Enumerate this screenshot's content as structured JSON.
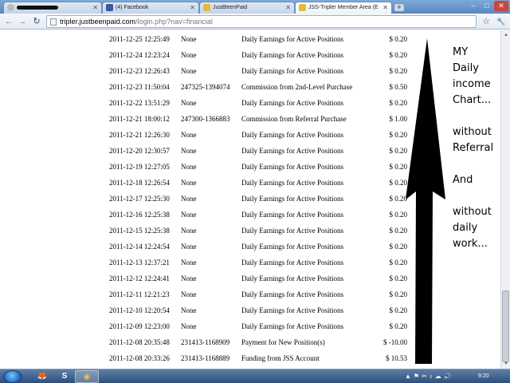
{
  "browser": {
    "tabs": [
      {
        "label": "",
        "redacted": true
      },
      {
        "label": "(4) Facebook"
      },
      {
        "label": "JustBeenPaid"
      },
      {
        "label": "JSS-Tripler Member Area (E",
        "active": true
      }
    ],
    "new_tab_label": "+",
    "window_controls": {
      "minimize": "–",
      "maximize": "□",
      "close": "✕"
    },
    "address": {
      "host": "tripler.justbeenpaid.com",
      "path": "/login.php?nav=financial"
    },
    "buttons": {
      "back": "←",
      "forward": "→",
      "reload": "↻",
      "star": "☆",
      "wrench": "🔧"
    }
  },
  "transactions": [
    {
      "date": "2011-12-25 12:25:49",
      "ref": "None",
      "description": "Daily Earnings for Active Positions",
      "amount": "$ 0.20"
    },
    {
      "date": "2011-12-24 12:23:24",
      "ref": "None",
      "description": "Daily Earnings for Active Positions",
      "amount": "$ 0.20"
    },
    {
      "date": "2011-12-23 12:26:43",
      "ref": "None",
      "description": "Daily Earnings for Active Positions",
      "amount": "$ 0.20"
    },
    {
      "date": "2011-12-23 11:50:04",
      "ref": "247325-1394074",
      "description": "Commission from 2nd-Level Purchase",
      "amount": "$ 0.50"
    },
    {
      "date": "2011-12-22 13:51:29",
      "ref": "None",
      "description": "Daily Earnings for Active Positions",
      "amount": "$ 0.20"
    },
    {
      "date": "2011-12-21 18:00:12",
      "ref": "247300-1366883",
      "description": "Commission from Referral Purchase",
      "amount": "$ 1.00"
    },
    {
      "date": "2011-12-21 12:26:30",
      "ref": "None",
      "description": "Daily Earnings for Active Positions",
      "amount": "$ 0.20"
    },
    {
      "date": "2011-12-20 12:30:57",
      "ref": "None",
      "description": "Daily Earnings for Active Positions",
      "amount": "$ 0.20"
    },
    {
      "date": "2011-12-19 12:27:05",
      "ref": "None",
      "description": "Daily Earnings for Active Positions",
      "amount": "$ 0.20"
    },
    {
      "date": "2011-12-18 12:26:54",
      "ref": "None",
      "description": "Daily Earnings for Active Positions",
      "amount": "$ 0.20"
    },
    {
      "date": "2011-12-17 12:25:30",
      "ref": "None",
      "description": "Daily Earnings for Active Positions",
      "amount": "$ 0.20"
    },
    {
      "date": "2011-12-16 12:25:38",
      "ref": "None",
      "description": "Daily Earnings for Active Positions",
      "amount": "$ 0.20"
    },
    {
      "date": "2011-12-15 12:25:38",
      "ref": "None",
      "description": "Daily Earnings for Active Positions",
      "amount": "$ 0.20"
    },
    {
      "date": "2011-12-14 12:24:54",
      "ref": "None",
      "description": "Daily Earnings for Active Positions",
      "amount": "$ 0.20"
    },
    {
      "date": "2011-12-13 12:37:21",
      "ref": "None",
      "description": "Daily Earnings for Active Positions",
      "amount": "$ 0.20"
    },
    {
      "date": "2011-12-12 12:24:41",
      "ref": "None",
      "description": "Daily Earnings for Active Positions",
      "amount": "$ 0.20"
    },
    {
      "date": "2011-12-11 12:21:23",
      "ref": "None",
      "description": "Daily Earnings for Active Positions",
      "amount": "$ 0.20"
    },
    {
      "date": "2011-12-10 12:20:54",
      "ref": "None",
      "description": "Daily Earnings for Active Positions",
      "amount": "$ 0.20"
    },
    {
      "date": "2011-12-09 12:23:00",
      "ref": "None",
      "description": "Daily Earnings for Active Positions",
      "amount": "$ 0.20"
    },
    {
      "date": "2011-12-08 20:35:48",
      "ref": "231413-1168909",
      "description": "Payment for New Position(s)",
      "amount": "$ -10.00"
    },
    {
      "date": "2011-12-08 20:33:26",
      "ref": "231413-1168889",
      "description": "Funding from JSS Account",
      "amount": "$ 10.53"
    }
  ],
  "annotation": {
    "lines": [
      "MY",
      "Daily",
      "income",
      "Chart...",
      "",
      "without",
      "Referral",
      "",
      "And",
      "",
      "without",
      "daily",
      "work..."
    ],
    "arrow_color": "#000000"
  },
  "taskbar": {
    "apps": [
      {
        "name": "firefox",
        "glyph": "🦊"
      },
      {
        "name": "skype",
        "glyph": "S"
      },
      {
        "name": "chrome",
        "glyph": "◉"
      }
    ],
    "tray_icons": [
      "▲",
      "⚑",
      "✂",
      "♪",
      "☁",
      "🔊"
    ],
    "clock": "9:20"
  },
  "colors": {
    "tab_strip": "#6f98cc",
    "taskbar": "#3d5f8c"
  }
}
